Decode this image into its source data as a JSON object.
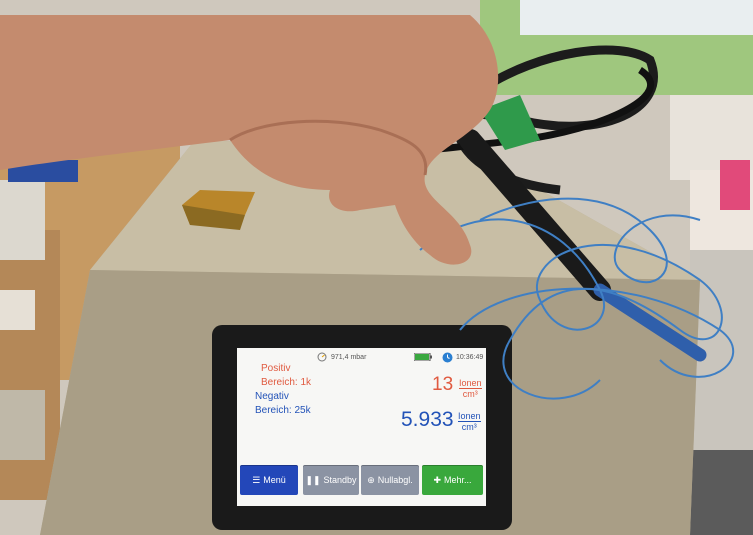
{
  "status_bar": {
    "pressure": "971,4 mbar",
    "time": "10:36:49"
  },
  "positive": {
    "title": "Positiv",
    "range": "Bereich: 1k",
    "value": "13",
    "unit_top": "Ionen",
    "unit_bottom": "cm³"
  },
  "negative": {
    "title": "Negativ",
    "range": "Bereich: 25k",
    "value": "5.933",
    "unit_top": "Ionen",
    "unit_bottom": "cm³"
  },
  "buttons": {
    "menu": "Menü",
    "standby": "Standby",
    "zero": "Nullabgl.",
    "more": "Mehr..."
  },
  "icons": [
    "gauge-icon",
    "battery-icon",
    "clock-icon",
    "menu-icon",
    "pause-icon",
    "zero-target-icon",
    "plus-icon"
  ],
  "colors": {
    "positive": "#e05a40",
    "negative": "#2353b8",
    "menu_button": "#2347b9",
    "gray_button": "#8b93a3",
    "more_button": "#39a83c"
  }
}
